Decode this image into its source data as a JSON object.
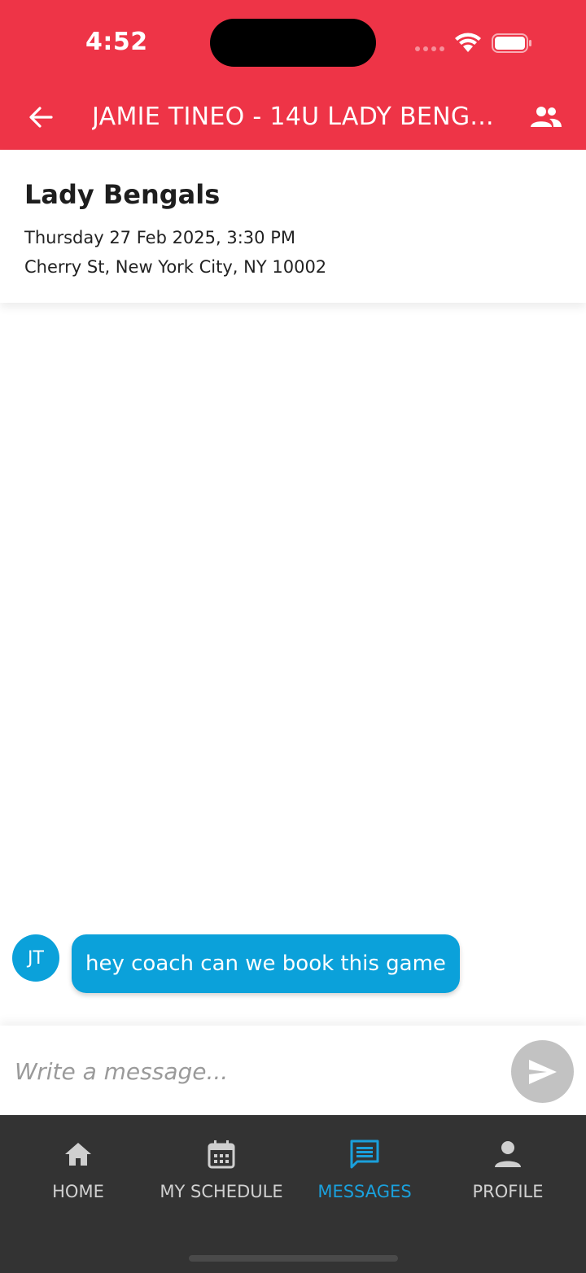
{
  "status_bar": {
    "time": "4:52"
  },
  "header": {
    "title": "JAMIE TINEO  - 14U LADY BENG..."
  },
  "event": {
    "title": "Lady Bengals",
    "datetime": "Thursday 27 Feb 2025, 3:30 PM",
    "location": "Cherry St, New York City, NY 10002"
  },
  "messages": [
    {
      "initials": "JT",
      "text": "hey coach can we book this game"
    }
  ],
  "composer": {
    "placeholder": "Write a message..."
  },
  "nav": {
    "items": [
      {
        "label": "HOME",
        "icon": "home-icon"
      },
      {
        "label": "MY SCHEDULE",
        "icon": "calendar-icon"
      },
      {
        "label": "MESSAGES",
        "icon": "message-icon",
        "active": true
      },
      {
        "label": "PROFILE",
        "icon": "person-icon"
      }
    ]
  },
  "colors": {
    "header": "#ee3447",
    "accent": "#0ba1da",
    "nav_background": "#333333",
    "nav_active": "#1aa0dc"
  }
}
